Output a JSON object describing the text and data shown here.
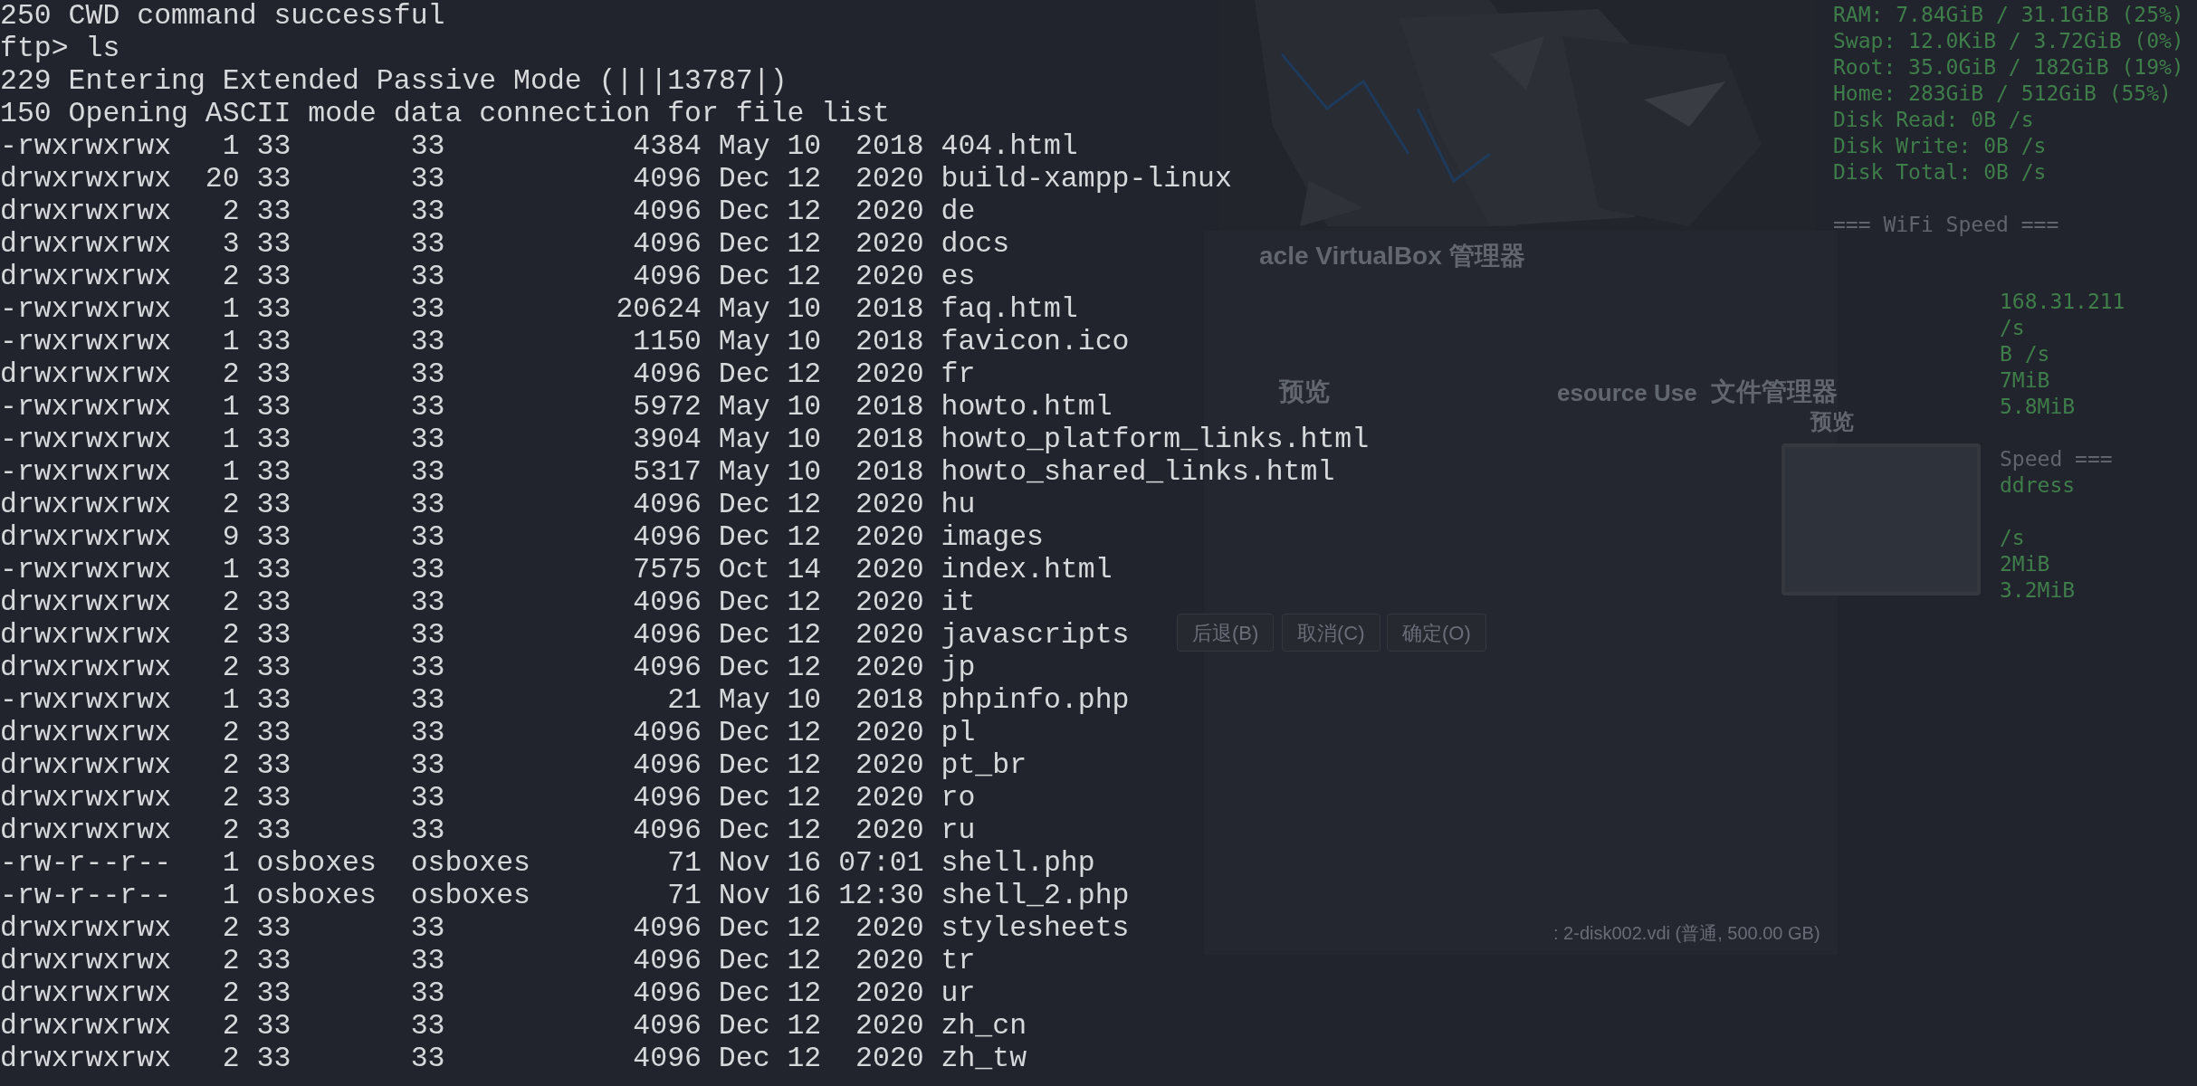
{
  "terminal": {
    "lines": [
      {
        "kind": "text",
        "text": "250 CWD command successful"
      },
      {
        "kind": "text",
        "text": "ftp> ls"
      },
      {
        "kind": "text",
        "text": "229 Entering Extended Passive Mode (|||13787|)"
      },
      {
        "kind": "text",
        "text": "150 Opening ASCII mode data connection for file list"
      },
      {
        "kind": "entry",
        "perms": "-rwxrwxrwx",
        "links": "1",
        "owner": "33",
        "group": "33",
        "size": "4384",
        "month": "May",
        "day": "10",
        "time": "2018",
        "name": "404.html"
      },
      {
        "kind": "entry",
        "perms": "drwxrwxrwx",
        "links": "20",
        "owner": "33",
        "group": "33",
        "size": "4096",
        "month": "Dec",
        "day": "12",
        "time": "2020",
        "name": "build-xampp-linux"
      },
      {
        "kind": "entry",
        "perms": "drwxrwxrwx",
        "links": "2",
        "owner": "33",
        "group": "33",
        "size": "4096",
        "month": "Dec",
        "day": "12",
        "time": "2020",
        "name": "de"
      },
      {
        "kind": "entry",
        "perms": "drwxrwxrwx",
        "links": "3",
        "owner": "33",
        "group": "33",
        "size": "4096",
        "month": "Dec",
        "day": "12",
        "time": "2020",
        "name": "docs"
      },
      {
        "kind": "entry",
        "perms": "drwxrwxrwx",
        "links": "2",
        "owner": "33",
        "group": "33",
        "size": "4096",
        "month": "Dec",
        "day": "12",
        "time": "2020",
        "name": "es"
      },
      {
        "kind": "entry",
        "perms": "-rwxrwxrwx",
        "links": "1",
        "owner": "33",
        "group": "33",
        "size": "20624",
        "month": "May",
        "day": "10",
        "time": "2018",
        "name": "faq.html"
      },
      {
        "kind": "entry",
        "perms": "-rwxrwxrwx",
        "links": "1",
        "owner": "33",
        "group": "33",
        "size": "1150",
        "month": "May",
        "day": "10",
        "time": "2018",
        "name": "favicon.ico"
      },
      {
        "kind": "entry",
        "perms": "drwxrwxrwx",
        "links": "2",
        "owner": "33",
        "group": "33",
        "size": "4096",
        "month": "Dec",
        "day": "12",
        "time": "2020",
        "name": "fr"
      },
      {
        "kind": "entry",
        "perms": "-rwxrwxrwx",
        "links": "1",
        "owner": "33",
        "group": "33",
        "size": "5972",
        "month": "May",
        "day": "10",
        "time": "2018",
        "name": "howto.html"
      },
      {
        "kind": "entry",
        "perms": "-rwxrwxrwx",
        "links": "1",
        "owner": "33",
        "group": "33",
        "size": "3904",
        "month": "May",
        "day": "10",
        "time": "2018",
        "name": "howto_platform_links.html"
      },
      {
        "kind": "entry",
        "perms": "-rwxrwxrwx",
        "links": "1",
        "owner": "33",
        "group": "33",
        "size": "5317",
        "month": "May",
        "day": "10",
        "time": "2018",
        "name": "howto_shared_links.html"
      },
      {
        "kind": "entry",
        "perms": "drwxrwxrwx",
        "links": "2",
        "owner": "33",
        "group": "33",
        "size": "4096",
        "month": "Dec",
        "day": "12",
        "time": "2020",
        "name": "hu"
      },
      {
        "kind": "entry",
        "perms": "drwxrwxrwx",
        "links": "9",
        "owner": "33",
        "group": "33",
        "size": "4096",
        "month": "Dec",
        "day": "12",
        "time": "2020",
        "name": "images"
      },
      {
        "kind": "entry",
        "perms": "-rwxrwxrwx",
        "links": "1",
        "owner": "33",
        "group": "33",
        "size": "7575",
        "month": "Oct",
        "day": "14",
        "time": "2020",
        "name": "index.html"
      },
      {
        "kind": "entry",
        "perms": "drwxrwxrwx",
        "links": "2",
        "owner": "33",
        "group": "33",
        "size": "4096",
        "month": "Dec",
        "day": "12",
        "time": "2020",
        "name": "it"
      },
      {
        "kind": "entry",
        "perms": "drwxrwxrwx",
        "links": "2",
        "owner": "33",
        "group": "33",
        "size": "4096",
        "month": "Dec",
        "day": "12",
        "time": "2020",
        "name": "javascripts"
      },
      {
        "kind": "entry",
        "perms": "drwxrwxrwx",
        "links": "2",
        "owner": "33",
        "group": "33",
        "size": "4096",
        "month": "Dec",
        "day": "12",
        "time": "2020",
        "name": "jp"
      },
      {
        "kind": "entry",
        "perms": "-rwxrwxrwx",
        "links": "1",
        "owner": "33",
        "group": "33",
        "size": "21",
        "month": "May",
        "day": "10",
        "time": "2018",
        "name": "phpinfo.php"
      },
      {
        "kind": "entry",
        "perms": "drwxrwxrwx",
        "links": "2",
        "owner": "33",
        "group": "33",
        "size": "4096",
        "month": "Dec",
        "day": "12",
        "time": "2020",
        "name": "pl"
      },
      {
        "kind": "entry",
        "perms": "drwxrwxrwx",
        "links": "2",
        "owner": "33",
        "group": "33",
        "size": "4096",
        "month": "Dec",
        "day": "12",
        "time": "2020",
        "name": "pt_br"
      },
      {
        "kind": "entry",
        "perms": "drwxrwxrwx",
        "links": "2",
        "owner": "33",
        "group": "33",
        "size": "4096",
        "month": "Dec",
        "day": "12",
        "time": "2020",
        "name": "ro"
      },
      {
        "kind": "entry",
        "perms": "drwxrwxrwx",
        "links": "2",
        "owner": "33",
        "group": "33",
        "size": "4096",
        "month": "Dec",
        "day": "12",
        "time": "2020",
        "name": "ru"
      },
      {
        "kind": "entry",
        "perms": "-rw-r--r--",
        "links": "1",
        "owner": "osboxes",
        "group": "osboxes",
        "size": "71",
        "month": "Nov",
        "day": "16",
        "time": "07:01",
        "name": "shell.php"
      },
      {
        "kind": "entry",
        "perms": "-rw-r--r--",
        "links": "1",
        "owner": "osboxes",
        "group": "osboxes",
        "size": "71",
        "month": "Nov",
        "day": "16",
        "time": "12:30",
        "name": "shell_2.php"
      },
      {
        "kind": "entry",
        "perms": "drwxrwxrwx",
        "links": "2",
        "owner": "33",
        "group": "33",
        "size": "4096",
        "month": "Dec",
        "day": "12",
        "time": "2020",
        "name": "stylesheets"
      },
      {
        "kind": "entry",
        "perms": "drwxrwxrwx",
        "links": "2",
        "owner": "33",
        "group": "33",
        "size": "4096",
        "month": "Dec",
        "day": "12",
        "time": "2020",
        "name": "tr"
      },
      {
        "kind": "entry",
        "perms": "drwxrwxrwx",
        "links": "2",
        "owner": "33",
        "group": "33",
        "size": "4096",
        "month": "Dec",
        "day": "12",
        "time": "2020",
        "name": "ur"
      },
      {
        "kind": "entry",
        "perms": "drwxrwxrwx",
        "links": "2",
        "owner": "33",
        "group": "33",
        "size": "4096",
        "month": "Dec",
        "day": "12",
        "time": "2020",
        "name": "zh_cn"
      },
      {
        "kind": "entry",
        "perms": "drwxrwxrwx",
        "links": "2",
        "owner": "33",
        "group": "33",
        "size": "4096",
        "month": "Dec",
        "day": "12",
        "time": "2020",
        "name": "zh_tw"
      }
    ]
  },
  "system_monitor": {
    "lines": [
      {
        "kind": "stat",
        "text": "RAM: 7.84GiB / 31.1GiB (25%)"
      },
      {
        "kind": "stat",
        "text": "Swap: 12.0KiB / 3.72GiB (0%)"
      },
      {
        "kind": "stat",
        "text": "Root: 35.0GiB / 182GiB (19%)"
      },
      {
        "kind": "stat",
        "text": "Home: 283GiB / 512GiB (55%)"
      },
      {
        "kind": "stat",
        "text": "Disk Read: 0B /s"
      },
      {
        "kind": "stat",
        "text": "Disk Write: 0B /s"
      },
      {
        "kind": "stat",
        "text": "Disk Total: 0B /s"
      },
      {
        "kind": "gap"
      },
      {
        "kind": "heading",
        "text": "=== WiFi Speed ==="
      }
    ],
    "partial_lines": [
      {
        "kind": "gap"
      },
      {
        "kind": "gap"
      },
      {
        "kind": "stat",
        "text": "168.31.211"
      },
      {
        "kind": "stat",
        "text": "/s"
      },
      {
        "kind": "stat",
        "text": "B /s"
      },
      {
        "kind": "stat",
        "text": "7MiB"
      },
      {
        "kind": "stat",
        "text": "5.8MiB"
      },
      {
        "kind": "gap"
      },
      {
        "kind": "heading",
        "text": "Speed ==="
      },
      {
        "kind": "stat",
        "text": "ddress"
      },
      {
        "kind": "gap"
      },
      {
        "kind": "stat",
        "text": "/s"
      },
      {
        "kind": "stat",
        "text": "2MiB"
      },
      {
        "kind": "stat",
        "text": "3.2MiB"
      }
    ]
  },
  "background_window": {
    "title": "acle VirtualBox 管理器",
    "labels": [
      "预览",
      "esource Use",
      "文件管理器",
      "预览"
    ],
    "buttons": [
      "后退(B)",
      "取消(C)",
      "确定(O)"
    ],
    "disk": ": 2-disk002.vdi (普通, 500.00 GB)"
  }
}
